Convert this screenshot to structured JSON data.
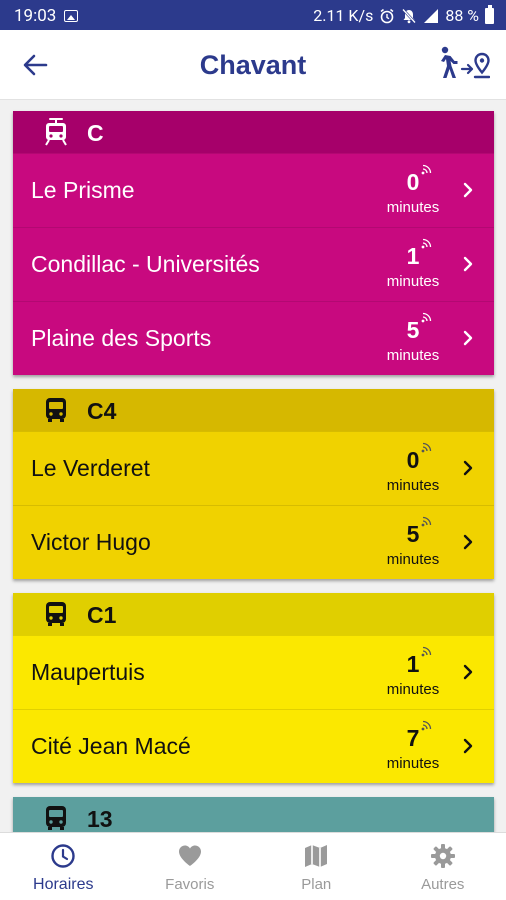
{
  "status_bar": {
    "time": "19:03",
    "speed": "2.11 K/s",
    "battery": "88 %"
  },
  "header": {
    "title": "Chavant"
  },
  "colors": {
    "brand": "#2c3a8c",
    "tram_c": "#c8097f",
    "tram_c_header": "#a6006a",
    "bus_c4": "#f0d200",
    "bus_c4_header": "#d6b800",
    "bus_c1": "#fbe800",
    "bus_c1_header": "#e0cf00",
    "bus_13": "#5c9f9e"
  },
  "lines": [
    {
      "name": "C",
      "vehicle": "tram-icon",
      "departures": [
        {
          "destination": "Le Prisme",
          "minutes": "0",
          "unit": "minutes"
        },
        {
          "destination": "Condillac - Universités",
          "minutes": "1",
          "unit": "minutes"
        },
        {
          "destination": "Plaine des Sports",
          "minutes": "5",
          "unit": "minutes"
        }
      ]
    },
    {
      "name": "C4",
      "vehicle": "bus-icon",
      "departures": [
        {
          "destination": "Le Verderet",
          "minutes": "0",
          "unit": "minutes"
        },
        {
          "destination": "Victor Hugo",
          "minutes": "5",
          "unit": "minutes"
        }
      ]
    },
    {
      "name": "C1",
      "vehicle": "bus-icon",
      "departures": [
        {
          "destination": "Maupertuis",
          "minutes": "1",
          "unit": "minutes"
        },
        {
          "destination": "Cité Jean Macé",
          "minutes": "7",
          "unit": "minutes"
        }
      ]
    },
    {
      "name": "13",
      "vehicle": "bus-icon",
      "departures": []
    }
  ],
  "tabs": [
    {
      "label": "Horaires",
      "icon": "clock-icon",
      "active": true
    },
    {
      "label": "Favoris",
      "icon": "heart-icon",
      "active": false
    },
    {
      "label": "Plan",
      "icon": "map-icon",
      "active": false
    },
    {
      "label": "Autres",
      "icon": "gear-icon",
      "active": false
    }
  ]
}
